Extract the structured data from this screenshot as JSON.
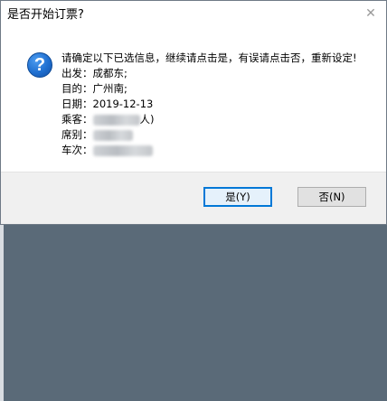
{
  "dialog": {
    "title": "是否开始订票?",
    "close_glyph": "✕",
    "icon_glyph": "?",
    "message": {
      "line1": "请确定以下已选信息，继续请点击是，有误请点击否，重新设定!",
      "from_label": "出发：",
      "from_value": "成都东;",
      "to_label": "目的：",
      "to_value": "广州南;",
      "date_label": "日期：",
      "date_value": "2019-12-13",
      "passenger_label": "乘客：",
      "passenger_suffix": "人)",
      "seat_label": "席别：",
      "train_label": "车次："
    },
    "buttons": {
      "yes_label": "是(Y)",
      "no_label": "否(N)"
    }
  }
}
